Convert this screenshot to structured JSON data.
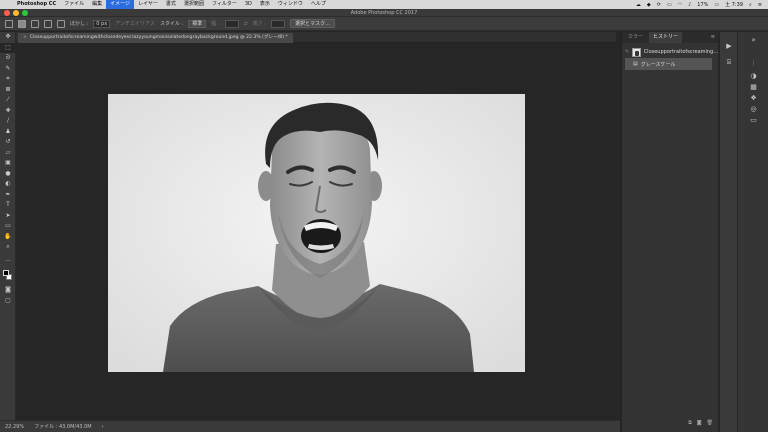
{
  "menubar": {
    "apple": "",
    "app": "Photoshop CC",
    "items": [
      "ファイル",
      "編集",
      "イメージ",
      "レイヤー",
      "書式",
      "選択範囲",
      "フィルター",
      "3D",
      "表示",
      "ウィンドウ",
      "ヘルプ"
    ],
    "active_index": 2,
    "battery": "17%",
    "time": "土 7:39"
  },
  "window": {
    "title": "Adobe Photoshop CC 2017"
  },
  "options_bar": {
    "feather_label": "ぼかし :",
    "feather_value": "0 px",
    "antialias_label": "アンチエイリアス",
    "style_label": "スタイル :",
    "style_value": "標準",
    "width_label": "幅 :",
    "height_label": "高さ :",
    "select_mask_button": "選択とマスク..."
  },
  "document": {
    "tab_title": "Closeupportraitofscreamingwithclosedeyescrazyyoungmanisolatedongraybackground.jpeg @ 22.3% (グレー/8) *",
    "close_symbol": "×"
  },
  "status": {
    "zoom": "22.29%",
    "file_info": "ファイル : 43.0M/43.0M",
    "arrow": "›"
  },
  "panel": {
    "tabs": [
      "カラー",
      "ヒストリー"
    ],
    "active_tab": 1,
    "menu_glyph": "≡",
    "history": [
      {
        "type": "snapshot",
        "label": "Closeupportraitofscreaming..."
      },
      {
        "type": "step",
        "label": "グレースケール"
      }
    ]
  },
  "colors": {
    "menubar_active": "#2b6de0",
    "close_dot": "#ff5f57",
    "min_dot": "#febc2e",
    "max_dot": "#28c840"
  }
}
